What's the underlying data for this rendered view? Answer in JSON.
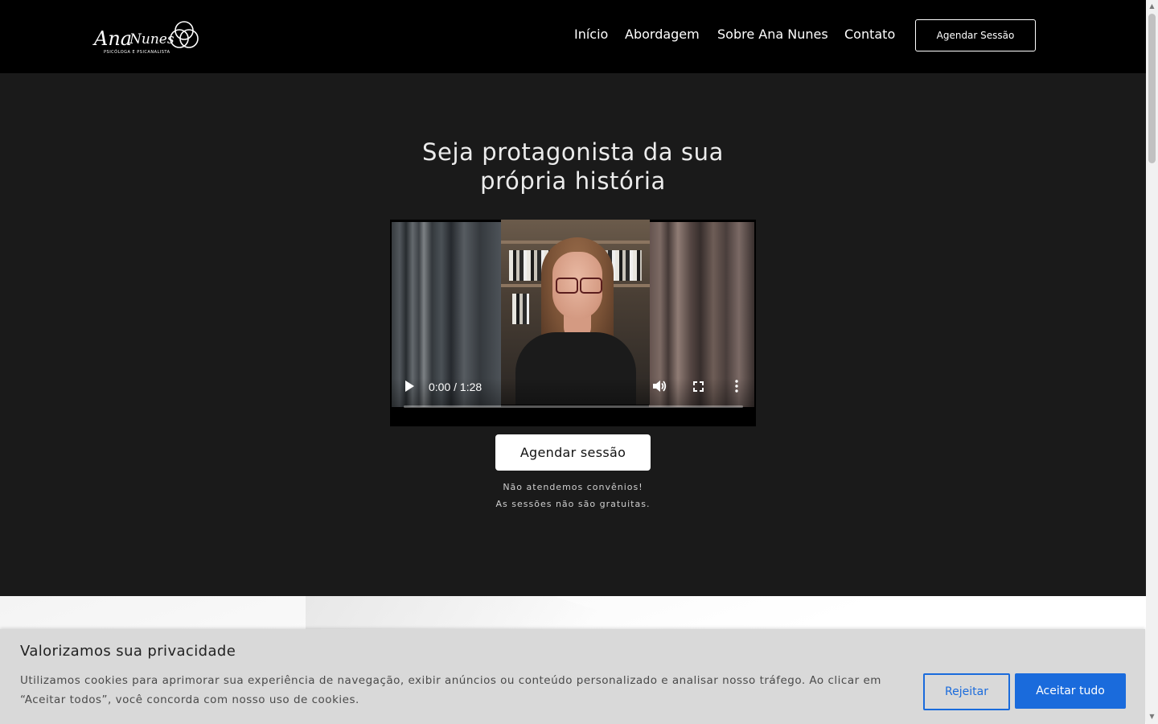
{
  "header": {
    "logo": {
      "name": "Ana Nunes",
      "tagline": "PSICÓLOGA E PSICANALISTA",
      "icon": "three-circles-logo-icon"
    },
    "nav": [
      {
        "label": "Início"
      },
      {
        "label": "Abordagem"
      },
      {
        "label": "Sobre Ana Nunes"
      },
      {
        "label": "Contato"
      }
    ],
    "cta_label": "Agendar Sessão"
  },
  "hero": {
    "title_line1": "Seja protagonista da sua",
    "title_line2": "própria história",
    "video": {
      "time": "0:00 / 1:28",
      "progress": 0,
      "icons": [
        "play-icon",
        "volume-icon",
        "fullscreen-icon",
        "more-options-icon"
      ]
    },
    "cta_label": "Agendar sessão",
    "note_line1": "Não atendemos convênios!",
    "note_line2": "As sessões não são gratuitas."
  },
  "cookie_banner": {
    "title": "Valorizamos sua privacidade",
    "text": "Utilizamos cookies para aprimorar sua experiência de navegação, exibir anúncios ou conteúdo personalizado e analisar nosso tráfego. Ao clicar em “Aceitar todos”, você concorda com nosso uso de cookies.",
    "reject_label": "Rejeitar",
    "accept_label": "Aceitar tudo"
  },
  "colors": {
    "header_bg": "#000000",
    "hero_bg": "#1a1a1a",
    "accent_blue": "#1a6bdc",
    "cookie_bg": "#d9d9d9"
  }
}
